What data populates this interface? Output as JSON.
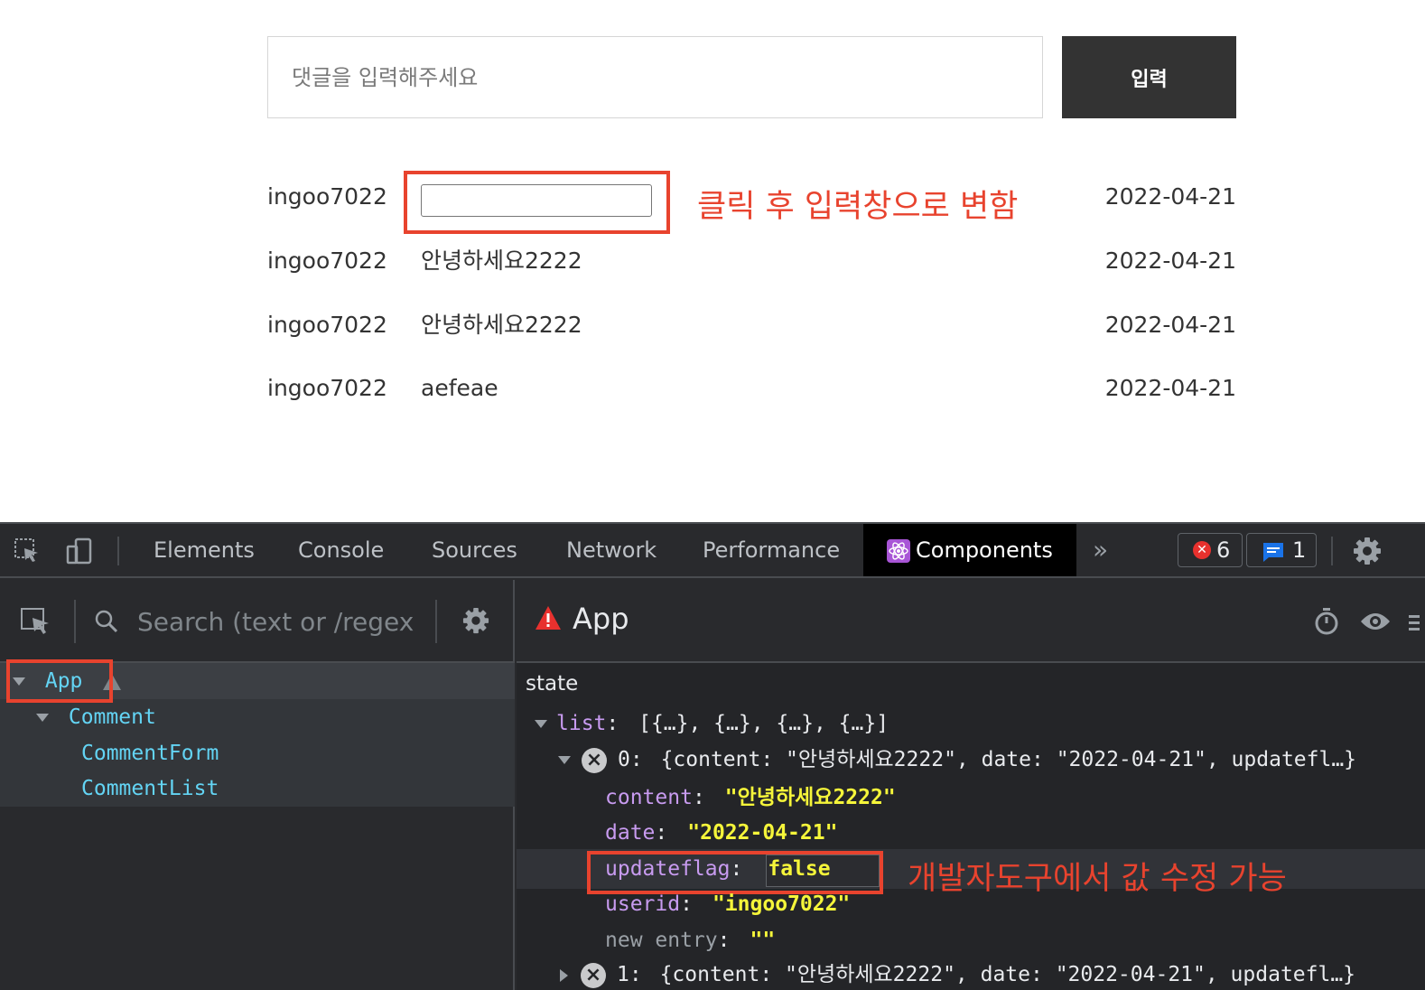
{
  "page": {
    "comment_placeholder": "댓글을 입력해주세요",
    "submit_label": "입력",
    "annotation_top": "클릭 후 입력창으로 변함",
    "rows": [
      {
        "userid": "ingoo7022",
        "content": "",
        "date": "2022-04-21",
        "editing": true
      },
      {
        "userid": "ingoo7022",
        "content": "안녕하세요2222",
        "date": "2022-04-21"
      },
      {
        "userid": "ingoo7022",
        "content": "안녕하세요2222",
        "date": "2022-04-21"
      },
      {
        "userid": "ingoo7022",
        "content": "aefeae",
        "date": "2022-04-21"
      }
    ]
  },
  "devtools": {
    "tabs": [
      "Elements",
      "Console",
      "Sources",
      "Network",
      "Performance",
      "Components"
    ],
    "active_tab": "Components",
    "more_tabs": "»",
    "error_count": "6",
    "message_count": "1",
    "search_placeholder": "Search (text or /regex/)",
    "tree": [
      {
        "label": "App",
        "warning": true
      },
      {
        "label": "Comment"
      },
      {
        "label": "CommentForm"
      },
      {
        "label": "CommentList"
      }
    ],
    "selected_component": "App",
    "state_label": "state",
    "list_key": "list",
    "list_preview": "[{…}, {…}, {…}, {…}]",
    "item0_key": "0",
    "item0_preview": "{content: \"안녕하세요2222\", date: \"2022-04-21\", updatefl…}",
    "props": [
      {
        "key": "content",
        "value": "\"안녕하세요2222\""
      },
      {
        "key": "date",
        "value": "\"2022-04-21\""
      },
      {
        "key": "updateflag",
        "value": "false"
      },
      {
        "key": "userid",
        "value": "\"ingoo7022\""
      },
      {
        "key": "new entry",
        "value": "\"\""
      }
    ],
    "item1_key": "1",
    "item1_preview": "{content: \"안녕하세요2222\", date: \"2022-04-21\", updatefl…}",
    "annotation_bottom": "개발자도구에서 값 수정 가능"
  },
  "colors": {
    "annotation_red": "#e8432e",
    "button_dark": "#333333",
    "devtools_bg": "#292a2d",
    "component_blue": "#63d4f4",
    "key_purple": "#c89bf0",
    "string_yellow": "#f5f53a"
  }
}
